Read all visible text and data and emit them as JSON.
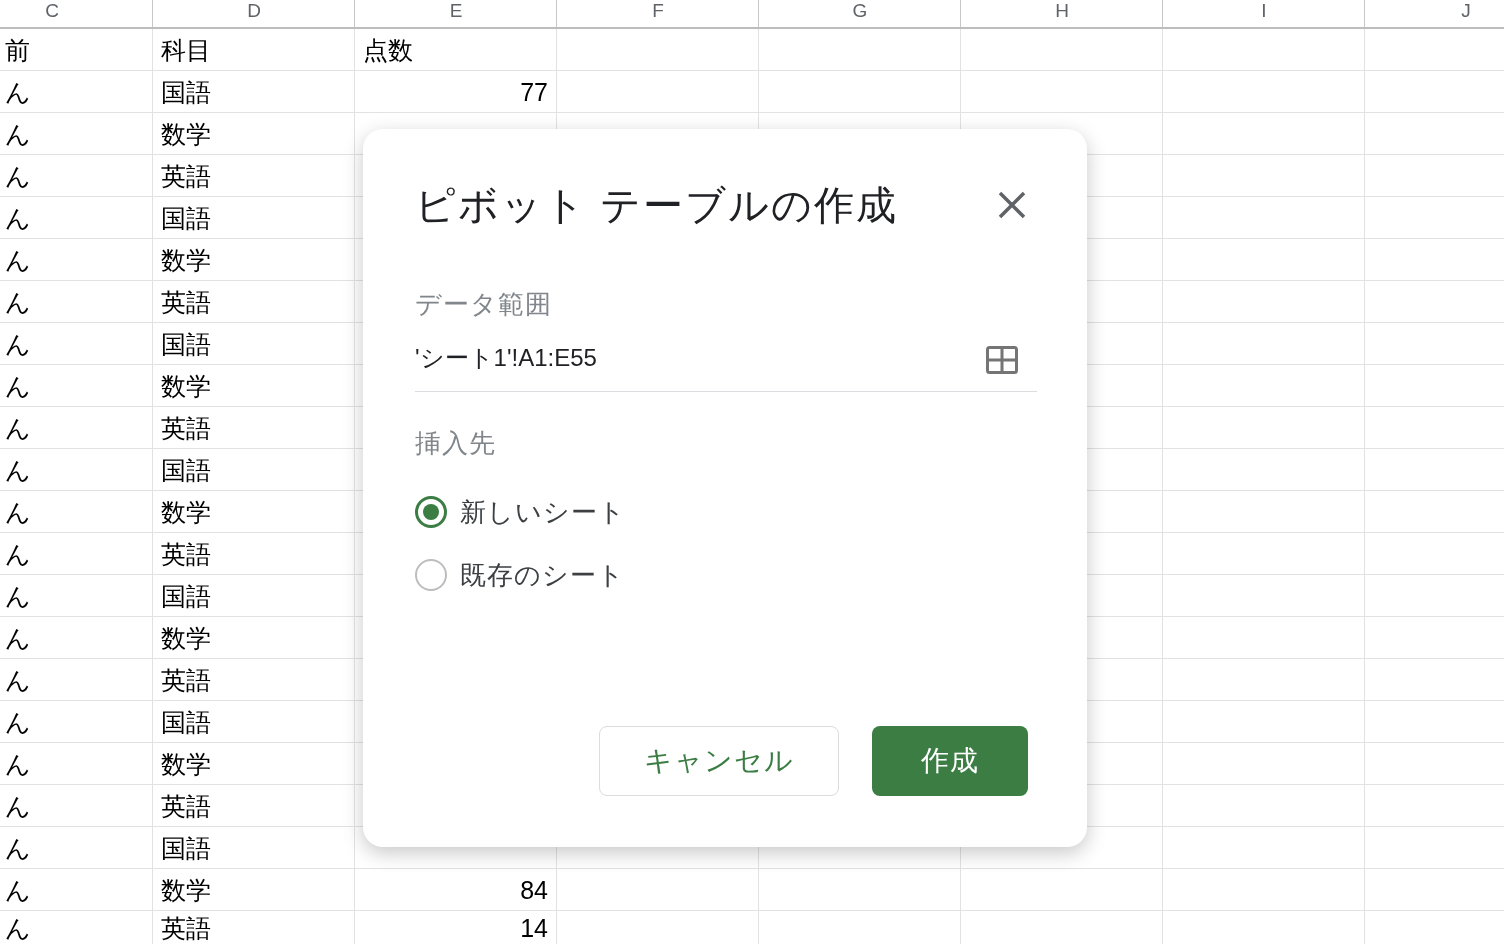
{
  "sheet": {
    "column_headers": [
      "C",
      "D",
      "E",
      "F",
      "G",
      "H",
      "I",
      "J"
    ],
    "header_row": {
      "column_c": "前",
      "column_d": "科目",
      "column_e": "点数"
    },
    "rows": [
      {
        "column_c": "ん",
        "column_d": "国語",
        "column_e": "77"
      },
      {
        "column_c": "ん",
        "column_d": "数学"
      },
      {
        "column_c": "ん",
        "column_d": "英語"
      },
      {
        "column_c": "ん",
        "column_d": "国語"
      },
      {
        "column_c": "ん",
        "column_d": "数学"
      },
      {
        "column_c": "ん",
        "column_d": "英語"
      },
      {
        "column_c": "ん",
        "column_d": "国語"
      },
      {
        "column_c": "ん",
        "column_d": "数学"
      },
      {
        "column_c": "ん",
        "column_d": "英語"
      },
      {
        "column_c": "ん",
        "column_d": "国語"
      },
      {
        "column_c": "ん",
        "column_d": "数学"
      },
      {
        "column_c": "ん",
        "column_d": "英語"
      },
      {
        "column_c": "ん",
        "column_d": "国語"
      },
      {
        "column_c": "ん",
        "column_d": "数学"
      },
      {
        "column_c": "ん",
        "column_d": "英語"
      },
      {
        "column_c": "ん",
        "column_d": "国語"
      },
      {
        "column_c": "ん",
        "column_d": "数学"
      },
      {
        "column_c": "ん",
        "column_d": "英語"
      },
      {
        "column_c": "ん",
        "column_d": "国語"
      },
      {
        "column_c": "ん",
        "column_d": "数学",
        "column_e": "84"
      },
      {
        "column_c": "ん",
        "column_d": "英語",
        "column_e": "14"
      }
    ]
  },
  "dialog": {
    "title": "ピボット テーブルの作成",
    "data_range": {
      "label": "データ範囲",
      "value": "'シート1'!A1:E55"
    },
    "insert_to": {
      "label": "挿入先",
      "options": [
        {
          "label": "新しいシート",
          "selected": true
        },
        {
          "label": "既存のシート",
          "selected": false
        }
      ]
    },
    "buttons": [
      {
        "label": "キャンセル",
        "kind": "secondary"
      },
      {
        "label": "作成",
        "kind": "primary"
      }
    ]
  }
}
